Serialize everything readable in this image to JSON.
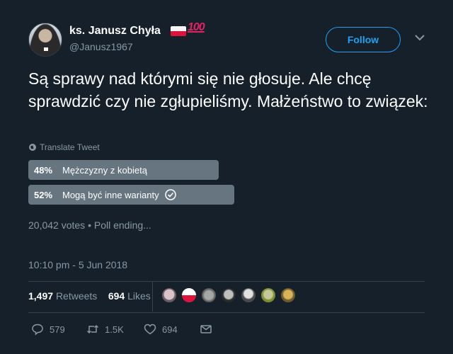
{
  "author": {
    "display_name": "ks. Janusz Chyła",
    "handle": "@Janusz1967",
    "emoji_hundred": "100"
  },
  "follow_label": "Follow",
  "tweet": {
    "text": "Są sprawy nad którymi się nie głosuje. Ale chcę sprawdzić czy nie zgłupieliśmy. Małżeństwo to związek:",
    "translate_label": "Translate Tweet"
  },
  "poll": {
    "options": [
      {
        "percent": "48%",
        "label": "Mężczyzny z kobietą",
        "fraction": 0.48,
        "winner": false
      },
      {
        "percent": "52%",
        "label": "Mogą być inne warianty",
        "fraction": 0.52,
        "winner": true
      }
    ],
    "votes": "20,042 votes",
    "status": "Poll ending..."
  },
  "timestamp": "10:10 pm - 5 Jun 2018",
  "stats": {
    "retweets_count": "1,497",
    "retweets_label": "Retweets",
    "likes_count": "694",
    "likes_label": "Likes"
  },
  "actions": {
    "replies": "579",
    "retweets": "1.5K",
    "likes": "694"
  },
  "colors": {
    "background": "#15202b",
    "accent": "#1da1f2",
    "secondary_text": "#8899a6",
    "poll_bar": "#66757f"
  }
}
